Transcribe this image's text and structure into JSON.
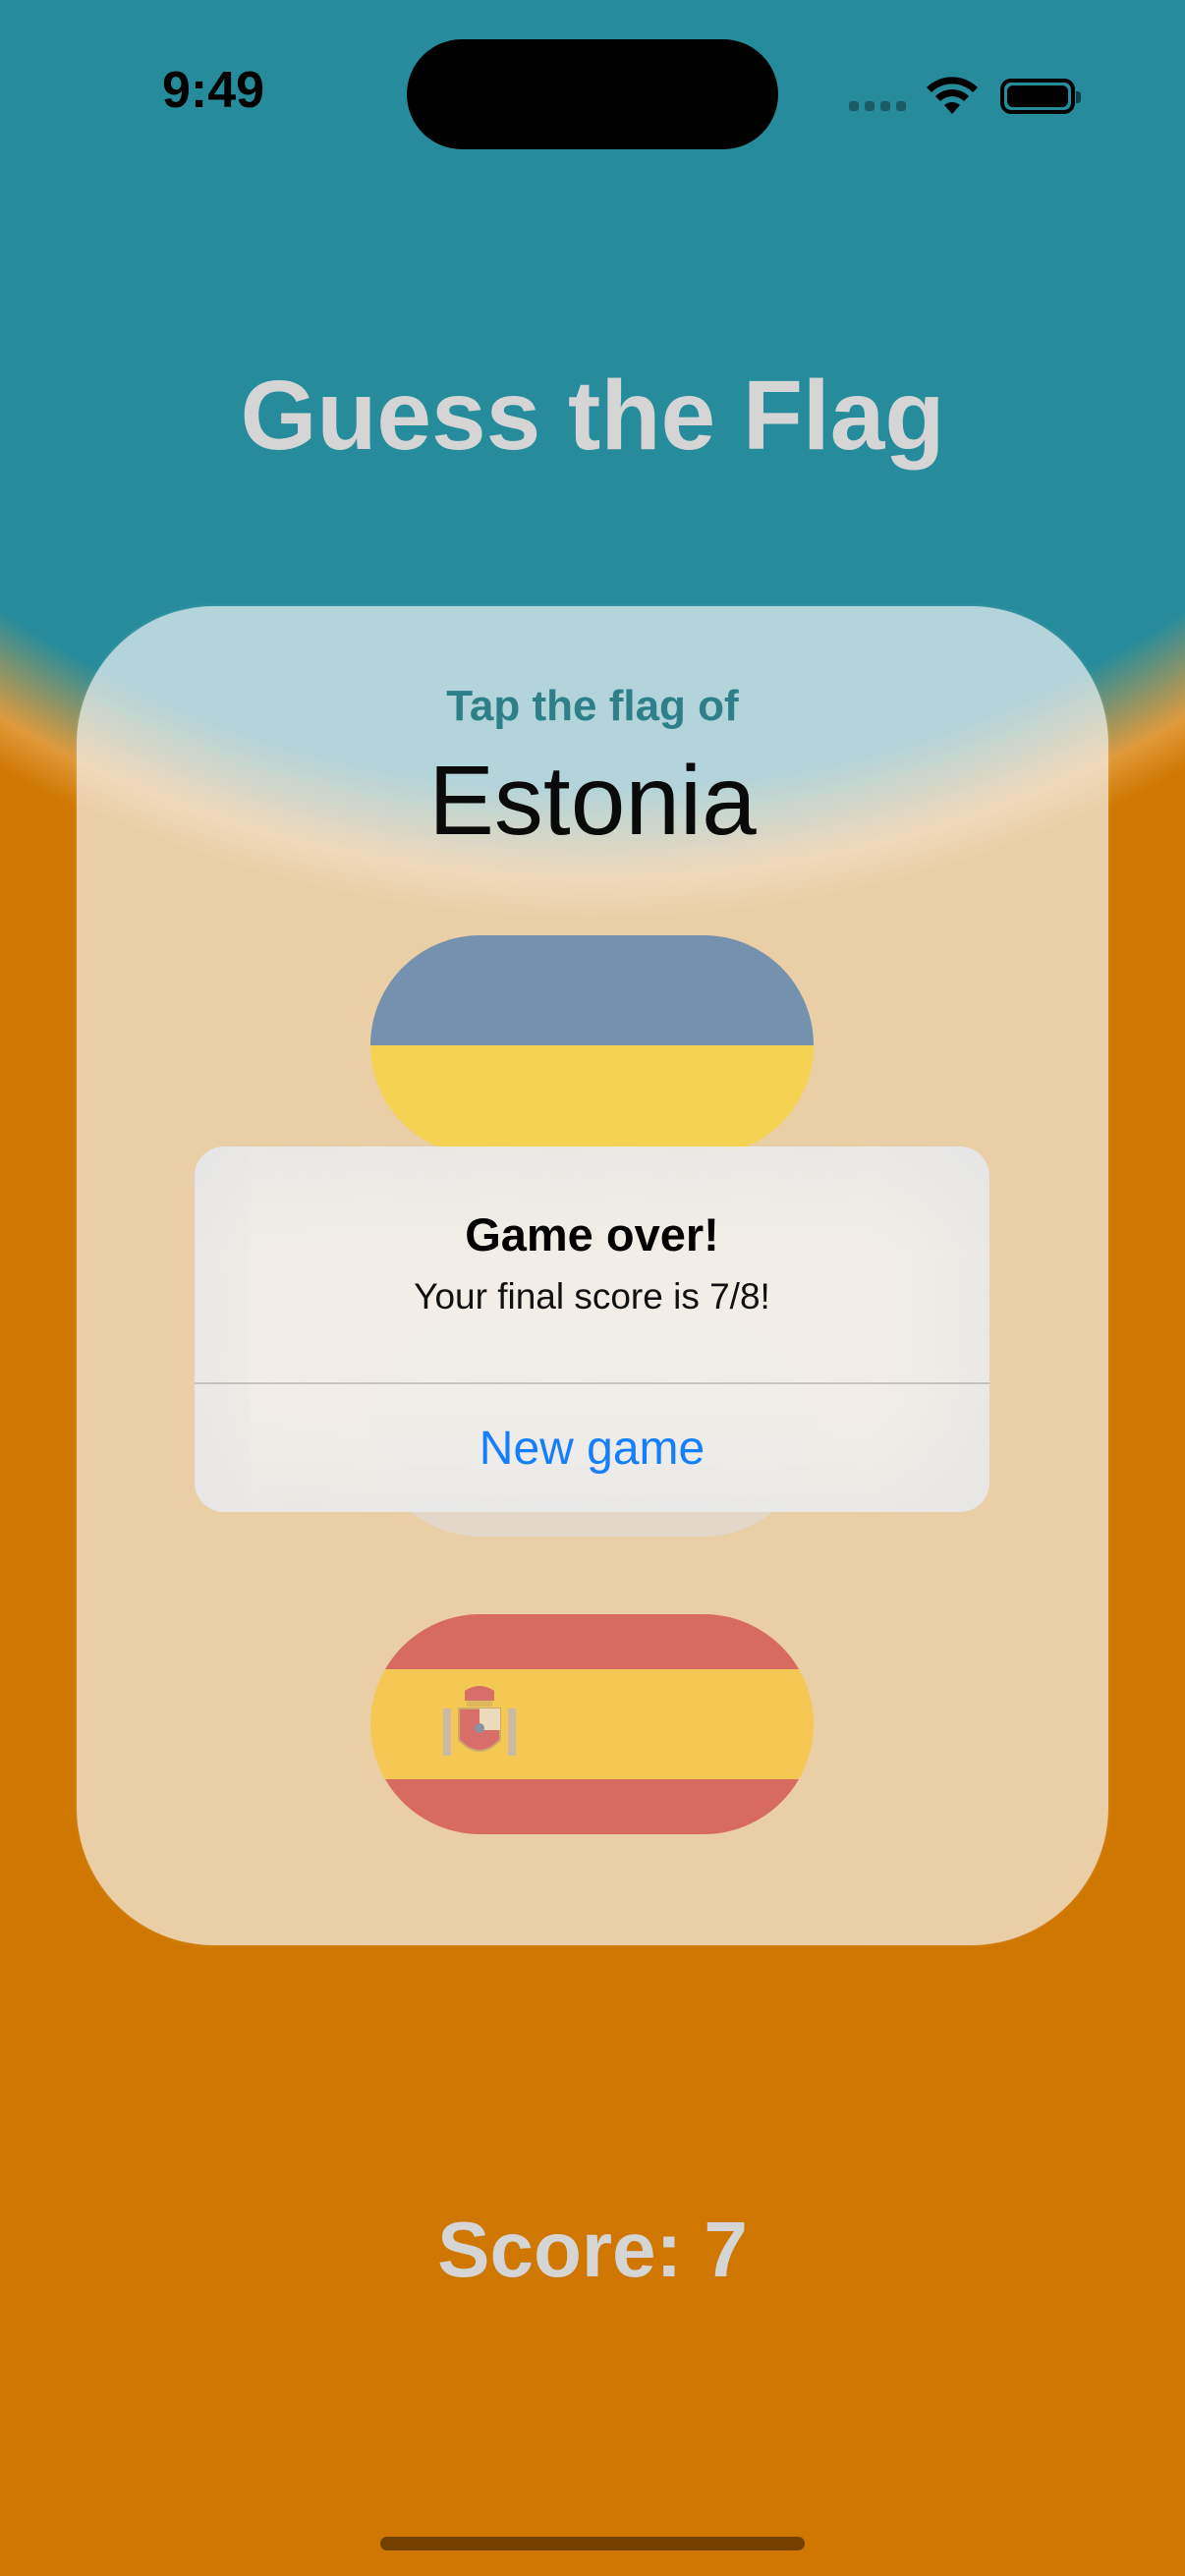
{
  "status_bar": {
    "time": "9:49",
    "icons": [
      "signal-icon",
      "wifi-icon",
      "battery-icon"
    ]
  },
  "title": "Guess the Flag",
  "card": {
    "prompt": "Tap the flag of",
    "country": "Estonia",
    "flags": [
      "Ukraine",
      "Spain"
    ]
  },
  "alert": {
    "title": "Game over!",
    "message": "Your final score is 7/8!",
    "button_label": "New game"
  },
  "score": "Score: 7",
  "colors": {
    "background_top": "#268c9c",
    "background_bottom": "#cf7700",
    "title_text": "#d5d5d5",
    "prompt_text": "#2d7f89",
    "alert_button": "#147efb"
  }
}
